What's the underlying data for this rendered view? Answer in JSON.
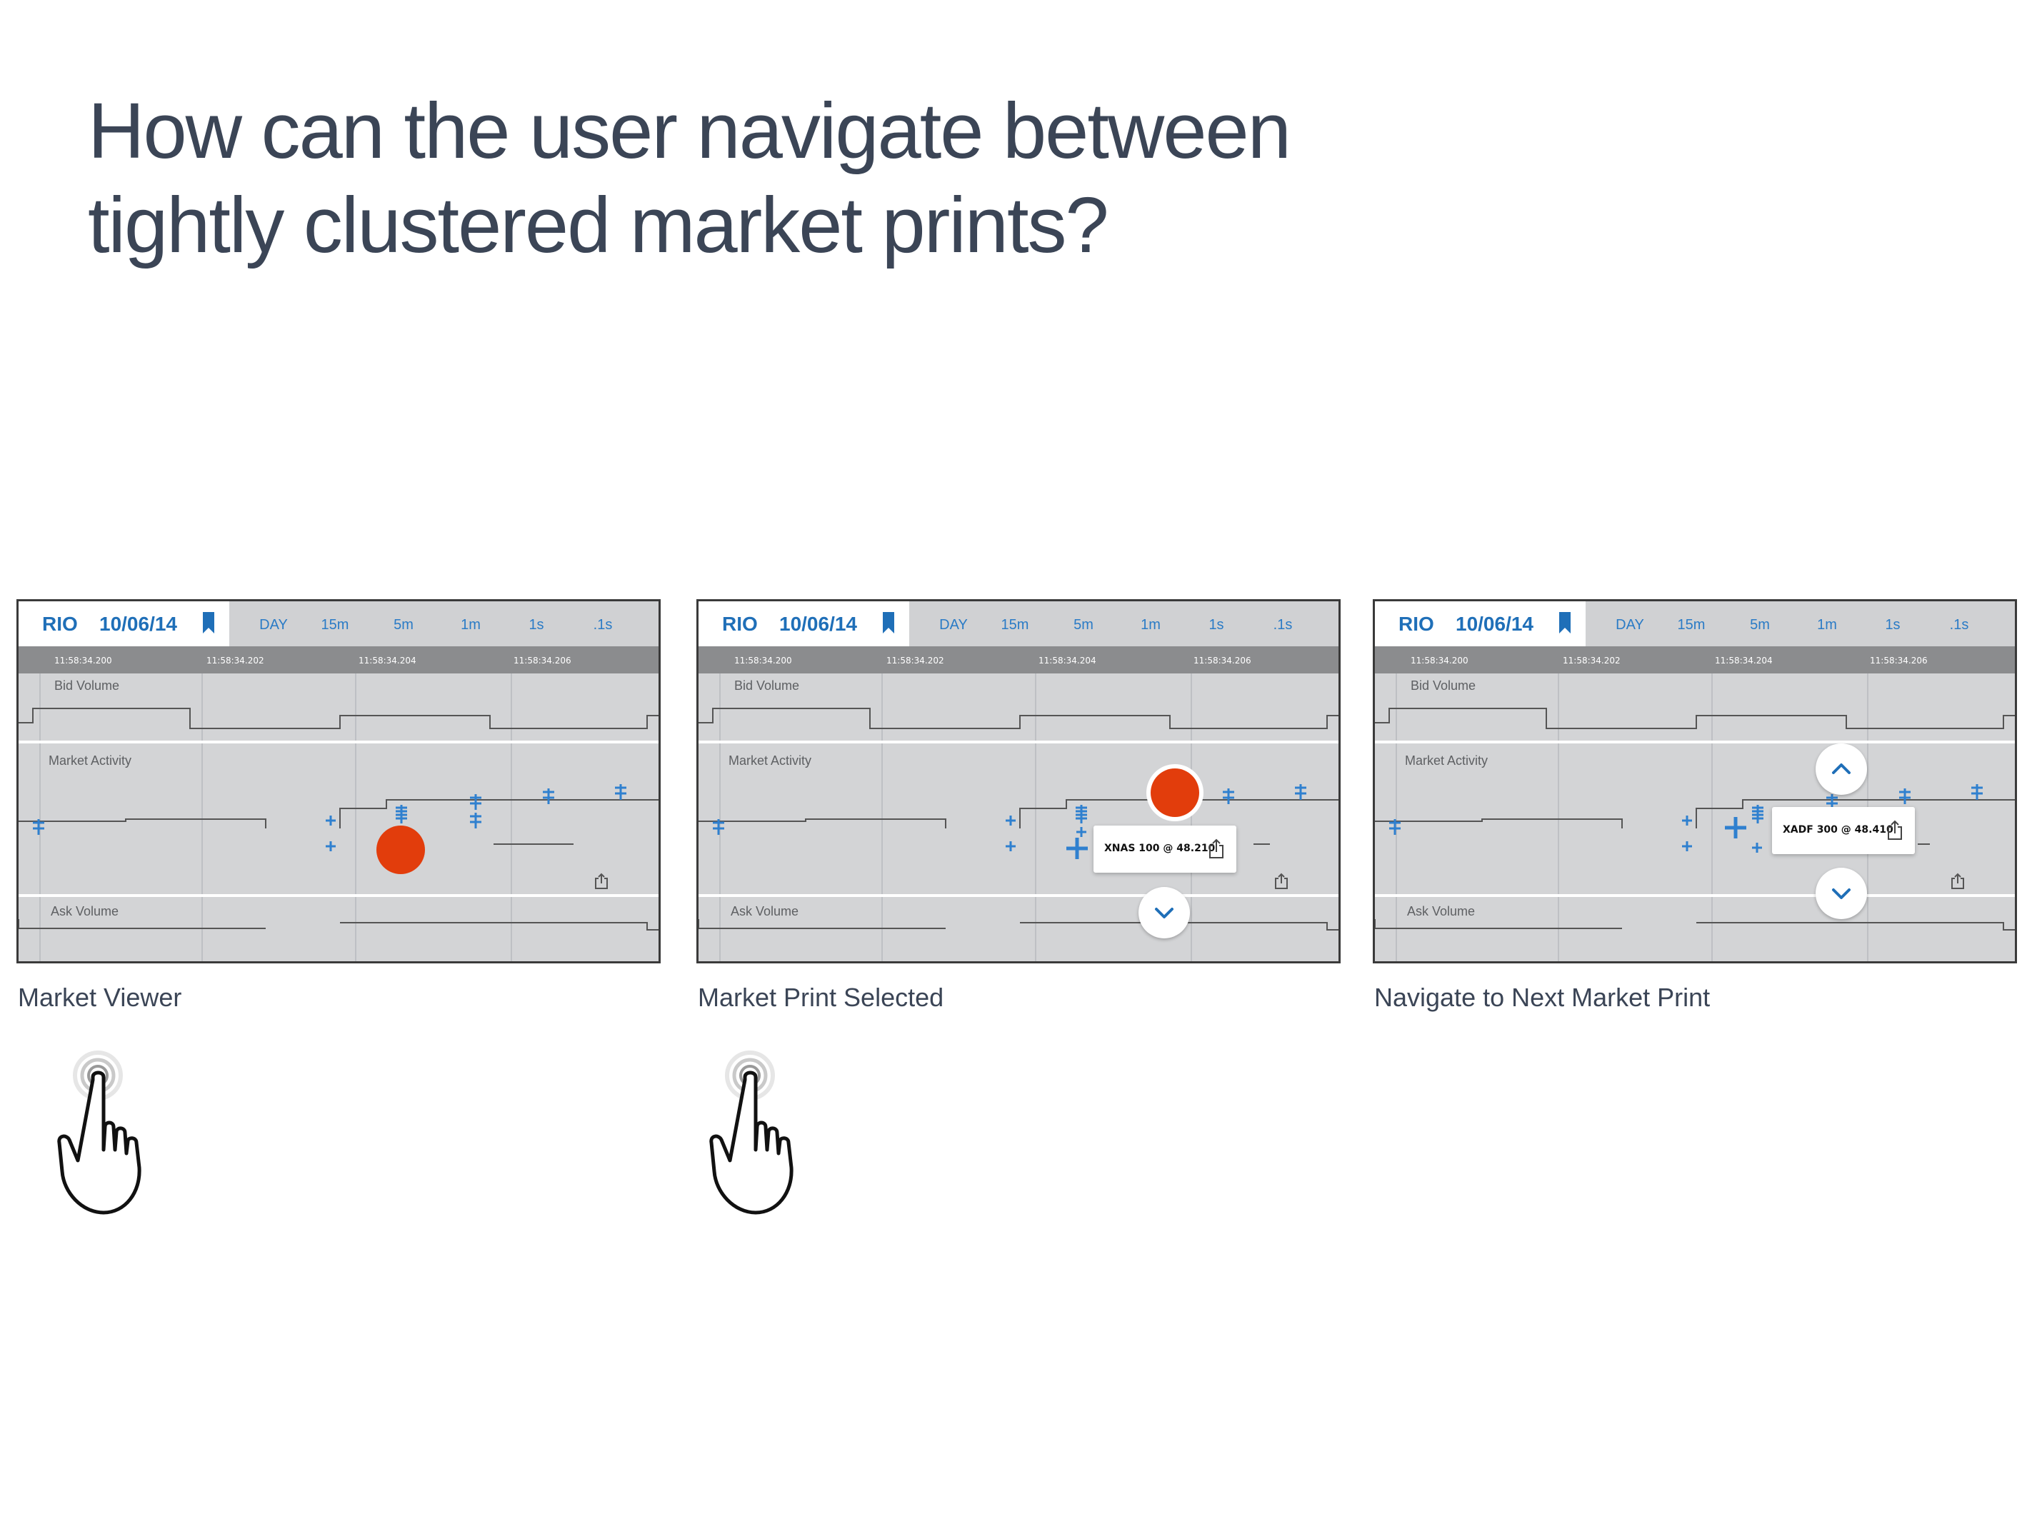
{
  "headline": {
    "line1": "How can the user navigate between",
    "line2": "tightly clustered market prints?"
  },
  "panel": {
    "ticker": "RIO",
    "date": "10/06/14",
    "tabs": [
      "DAY",
      "15m",
      "5m",
      "1m",
      "1s",
      ".1s"
    ],
    "ticks": [
      "11:58:34.200",
      "11:58:34.202",
      "11:58:34.204",
      "11:58:34.206"
    ],
    "lanes": {
      "bid": "Bid Volume",
      "activity": "Market Activity",
      "ask": "Ask Volume"
    }
  },
  "panels": [
    {
      "caption": "Market Viewer"
    },
    {
      "caption": "Market Print Selected",
      "tooltip": "XNAS 100 @ 48.210"
    },
    {
      "caption": "Navigate to Next Market Print",
      "tooltip": "XADF 300 @ 48.410"
    }
  ],
  "colors": {
    "accent": "#2a7bc6",
    "touch": "#e23d0c",
    "headline": "#3b4556"
  },
  "icons": [
    "bookmark-icon",
    "share-icon",
    "chevron-up-icon",
    "chevron-down-icon",
    "hand-tap-icon"
  ]
}
